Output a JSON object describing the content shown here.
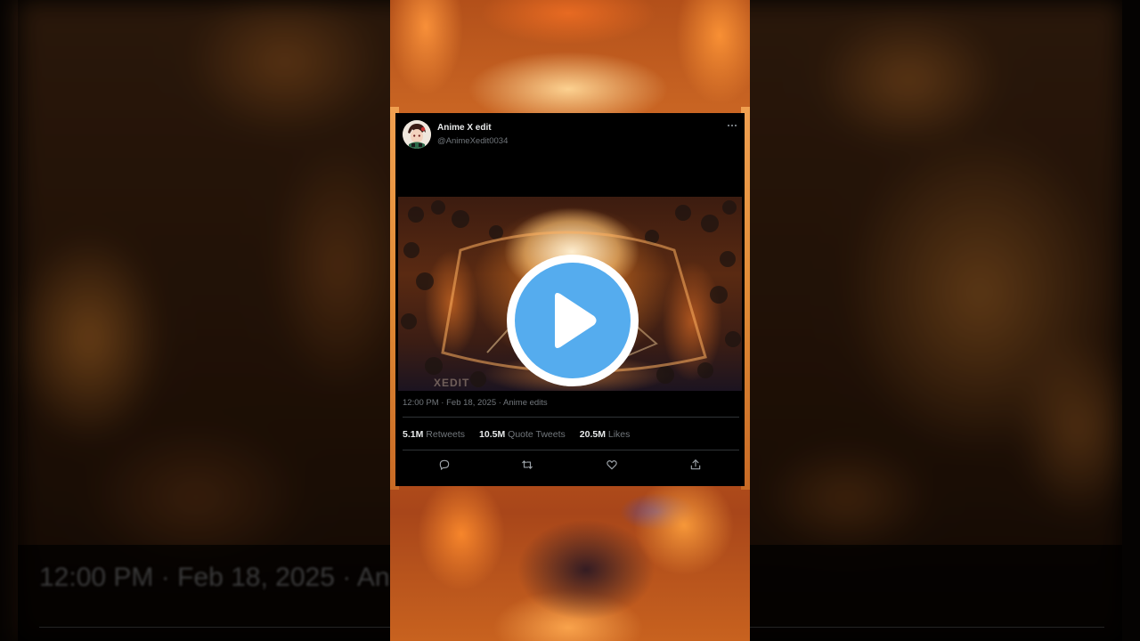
{
  "tweet": {
    "display_name": "Anime X edit",
    "handle": "@AnimeXedit0034",
    "avatar_icon": "anime-character-avatar",
    "timestamp": {
      "time": "12:00 PM",
      "date": "Feb 18, 2025",
      "separator": " · ",
      "source": "Anime edits"
    },
    "media": {
      "type": "video",
      "watermark": "XEDIT",
      "play_icon": "play-icon",
      "play_color": "#55acee"
    },
    "stats": [
      {
        "value": "5.1M",
        "label": "Retweets"
      },
      {
        "value": "10.5M",
        "label": "Quote Tweets"
      },
      {
        "value": "20.5M",
        "label": "Likes"
      }
    ],
    "actions": [
      "reply-icon",
      "retweet-icon",
      "like-icon",
      "share-icon"
    ]
  },
  "background": {
    "echo_text": "12:00 PM · Feb 18, 2025 · An"
  },
  "colors": {
    "card_background": "#000000",
    "primary_text": "#e7e9ea",
    "secondary_text": "#71767b",
    "divider": "#2f3336",
    "accent": "#55acee"
  }
}
